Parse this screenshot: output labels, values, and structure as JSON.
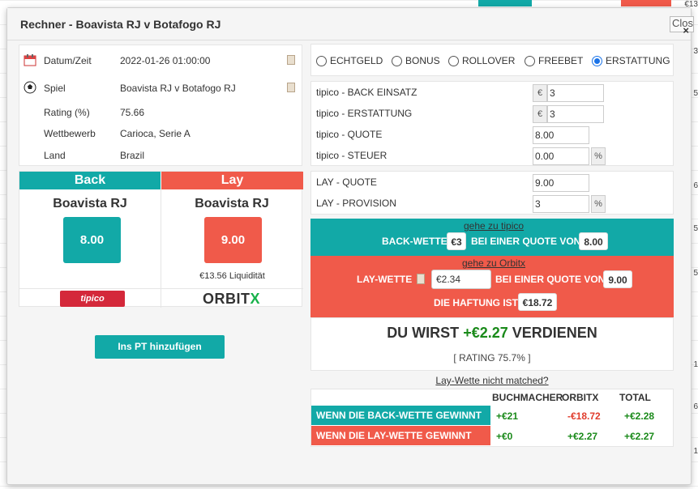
{
  "background": {
    "right_column": [
      "€13",
      "3",
      "5",
      "6",
      "5",
      "5",
      "1",
      "6",
      "1"
    ]
  },
  "dialog": {
    "title": "Rechner - Boavista RJ v Botafogo RJ",
    "close_label": "Close",
    "close_icon": "×"
  },
  "info": {
    "rows": [
      {
        "label": "Datum/Zeit",
        "value": "2022-01-26 01:00:00",
        "icon": "calendar-icon"
      },
      {
        "label": "Spiel",
        "value": "Boavista RJ v Botafogo RJ",
        "icon": "football-icon"
      },
      {
        "label": "Rating (%)",
        "value": "75.66"
      },
      {
        "label": "Wettbewerb",
        "value": "Carioca, Serie A"
      },
      {
        "label": "Land",
        "value": "Brazil"
      }
    ]
  },
  "backlay": {
    "back_header": "Back",
    "lay_header": "Lay",
    "back_team": "Boavista RJ",
    "lay_team": "Boavista RJ",
    "back_odds": "8.00",
    "lay_odds": "9.00",
    "liquidity": "€13.56 Liquidität",
    "back_bookmaker": "tipico",
    "lay_exchange_main": "ORBIT",
    "lay_exchange_x": "X"
  },
  "add_pt_button": "Ins PT hinzufügen",
  "modes": [
    {
      "label": "ECHTGELD",
      "selected": false
    },
    {
      "label": "BONUS",
      "selected": false
    },
    {
      "label": "ROLLOVER",
      "selected": false
    },
    {
      "label": "FREEBET",
      "selected": false
    },
    {
      "label": "ERSTATTUNG",
      "selected": true
    }
  ],
  "back_form": {
    "stake_label": "tipico - BACK EINSATZ",
    "stake_currency": "€",
    "stake_value": "3",
    "refund_label": "tipico - ERSTATTUNG",
    "refund_currency": "€",
    "refund_value": "3",
    "odds_label": "tipico - QUOTE",
    "odds_value": "8.00",
    "tax_label": "tipico - STEUER",
    "tax_value": "0.00",
    "tax_unit": "%"
  },
  "lay_form": {
    "odds_label": "LAY - QUOTE",
    "odds_value": "9.00",
    "commission_label": "LAY - PROVISION",
    "commission_value": "3",
    "commission_unit": "%"
  },
  "back_instruction": {
    "link": "gehe zu tipico",
    "prefix": "BACK-WETTE",
    "stake": "€3",
    "middle": "BEI EINER QUOTE VON",
    "odds": "8.00"
  },
  "lay_instruction": {
    "link": "gehe zu Orbitx",
    "prefix": "LAY-WETTE",
    "stake": "€2.34",
    "middle": "BEI EINER QUOTE VON",
    "odds": "9.00",
    "liability_label": "DIE HAFTUNG IST",
    "liability": "€18.72"
  },
  "result": {
    "prefix": "DU WIRST",
    "amount": "+€2.27",
    "suffix": "VERDIENEN",
    "rating": "[ RATING 75.7% ]"
  },
  "lay_not_matched": "Lay-Wette nicht matched?",
  "outcomes": {
    "headers": [
      "BUCHMACHER",
      "ORBITX",
      "TOTAL"
    ],
    "rows": [
      {
        "label": "WENN DIE BACK-WETTE GEWINNT",
        "bookmaker": "+€21",
        "exchange": "-€18.72",
        "total": "+€2.28"
      },
      {
        "label": "WENN DIE LAY-WETTE GEWINNT",
        "bookmaker": "+€0",
        "exchange": "+€2.27",
        "total": "+€2.27"
      }
    ]
  },
  "colors": {
    "back": "#12a9a7",
    "lay": "#f05a4a",
    "positive": "#1a8a1a",
    "negative": "#e03c2c",
    "radio_selected": "#1a73e8"
  }
}
